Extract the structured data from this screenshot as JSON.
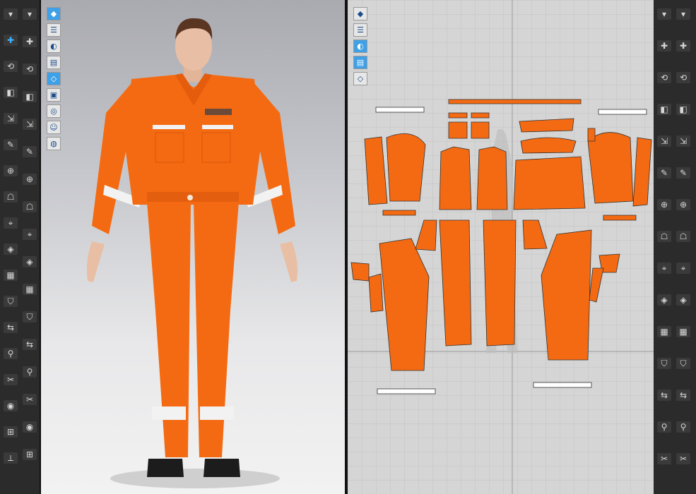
{
  "app": {
    "accent_color": "#3fb3ff",
    "garment_color": "#f46a12",
    "reflective_tape_color": "#f2f2f2"
  },
  "left_toolbar": {
    "col1": [
      "arrow-down-icon",
      "move-icon",
      "transform-pattern-icon",
      "rotate-garment-icon",
      "fold-icon",
      "drape-icon",
      "tack-icon",
      "avatar-icon",
      "pin-icon",
      "edit-point-icon",
      "pattern-icon",
      "shirt-icon",
      "sewing-icon",
      "hanger-icon",
      "measure-icon",
      "cut-icon",
      "button-icon",
      "zipper-icon"
    ],
    "col2": [
      "walk-icon",
      "select-mesh-icon",
      "brush-icon",
      "edit-mesh-icon",
      "seam-icon",
      "line-icon",
      "fabric-icon",
      "texture-icon",
      "button-place-icon",
      "topstitch-icon",
      "gather-icon",
      "graphic-icon",
      "puckering-icon",
      "trim-icon",
      "block-icon",
      "flip-icon",
      "expand-icon"
    ]
  },
  "view3d": {
    "tools": [
      "3d-view-icon",
      "show-garment-icon",
      "show-avatar-icon",
      "texture-view-icon",
      "wireframe-icon",
      "thickness-icon",
      "fabric-render-icon",
      "skin-icon",
      "globe-icon"
    ]
  },
  "view2d": {
    "tools": [
      "eye-icon",
      "garment-view-icon",
      "info-icon",
      "pattern-view-icon",
      "avatar-silhouette-icon"
    ]
  },
  "right_toolbar": {
    "col1": [
      "select-icon",
      "add-pattern-icon",
      "rectangle-icon",
      "polygon-icon",
      "circle-icon",
      "dart-icon",
      "internal-line-icon",
      "seam-line-icon",
      "edit-curve-icon",
      "grade-icon",
      "ruler-icon",
      "text-icon",
      "annotation-icon",
      "grid-icon",
      "symmetry-icon"
    ],
    "col2": [
      "undo-icon",
      "redo-icon",
      "fold-arrange-icon",
      "unfold-icon",
      "iron-icon",
      "shirt-preview-icon",
      "sew-pattern-icon",
      "segment-sew-icon",
      "free-sew-icon",
      "notch-icon",
      "measure-line-icon",
      "stitch-icon",
      "buttonhole-icon",
      "block-arrange-icon",
      "bug-icon"
    ]
  }
}
